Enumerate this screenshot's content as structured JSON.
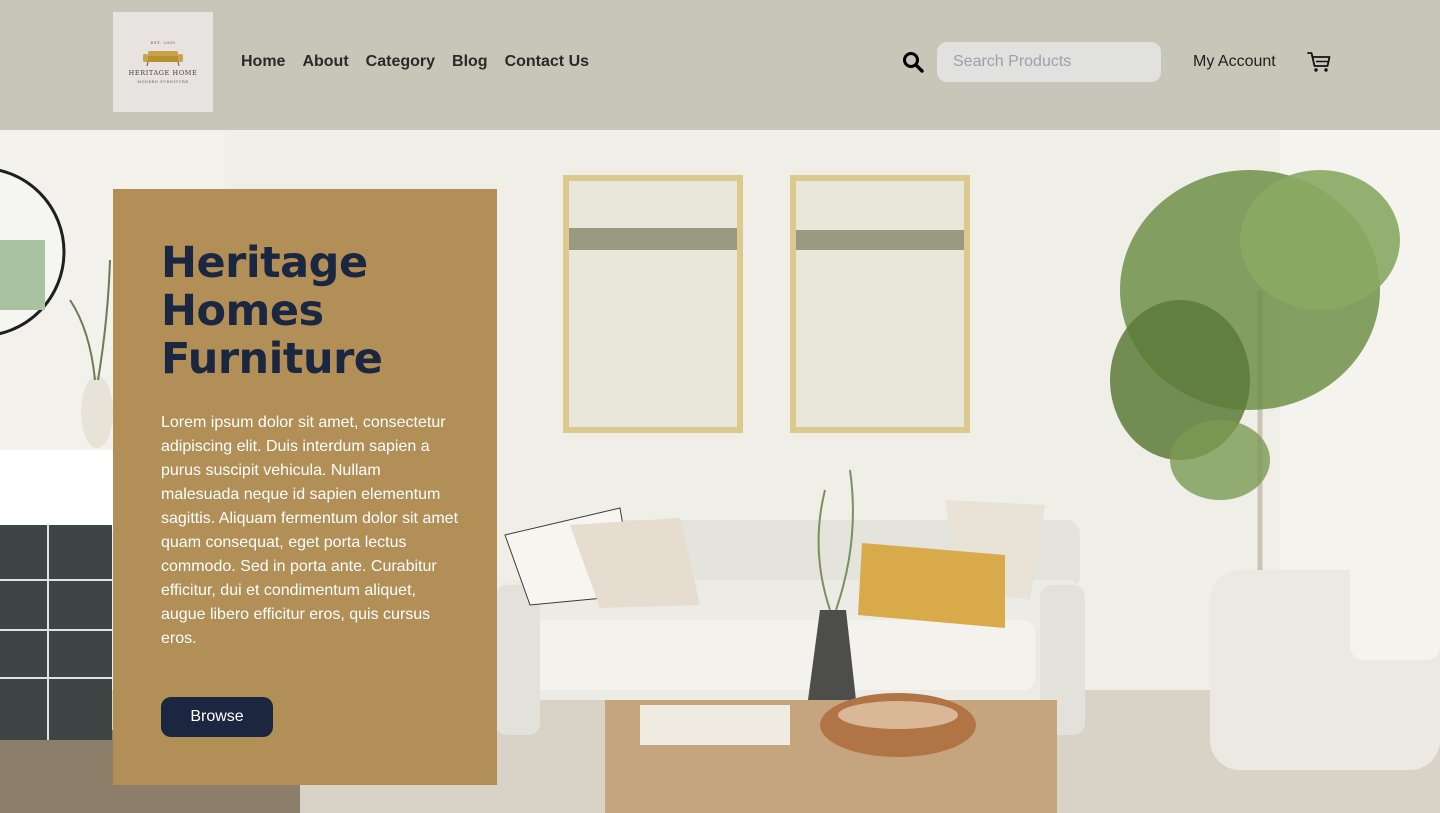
{
  "brand": {
    "logo_est": "EST. 2005",
    "logo_name": "HERITAGE HOME",
    "logo_tagline": "MODERN FURNITURE"
  },
  "nav": {
    "items": [
      {
        "label": "Home"
      },
      {
        "label": "About"
      },
      {
        "label": "Category"
      },
      {
        "label": "Blog"
      },
      {
        "label": "Contact Us"
      }
    ]
  },
  "search": {
    "icon": "search-icon",
    "placeholder": "Search Products",
    "value": ""
  },
  "account": {
    "label": "My Account"
  },
  "cart": {
    "icon": "cart-icon"
  },
  "hero": {
    "title": "Heritage Homes Furniture",
    "description": "Lorem ipsum dolor sit amet, consectetur adipiscing elit. Duis interdum sapien a purus suscipit vehicula. Nullam malesuada neque id sapien elementum sagittis. Aliquam fermentum dolor sit amet quam consequat, eget porta lectus commodo. Sed in porta ante. Curabitur efficitur, dui et condimentum aliquet, augue libero efficitur eros, quis cursus eros.",
    "button_label": "Browse"
  },
  "colors": {
    "header_bg": "#c8c6b9",
    "card_bg": "#b18f56",
    "title_color": "#1b2640",
    "button_bg": "#1b2640"
  }
}
